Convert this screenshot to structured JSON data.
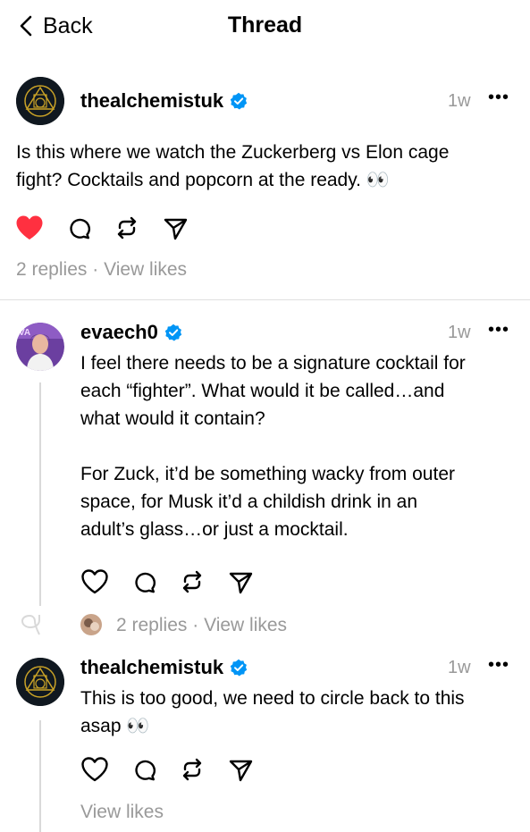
{
  "header": {
    "back_label": "Back",
    "title": "Thread"
  },
  "post": {
    "username": "thealchemistuk",
    "time": "1w",
    "text_line1": "Is this where we watch the Zuckerberg vs Elon cage",
    "text_line2": "fight? Cocktails and popcorn at the ready.",
    "emoji": "👀",
    "liked": true,
    "replies_label": "2 replies",
    "separator": "·",
    "likes_label": "View likes"
  },
  "reply1": {
    "username": "evaech0",
    "time": "1w",
    "lines": [
      "I feel there needs to be a signature cocktail for",
      "each “fighter”. What would it be called…and",
      "what would it contain?",
      "",
      "For Zuck, it’d be something wacky from outer",
      "space, for Musk it’d a childish drink in an",
      "adult’s glass…or just a mocktail."
    ],
    "replies_label": "2 replies",
    "separator": "·",
    "likes_label": "View likes"
  },
  "reply2": {
    "username": "thealchemistuk",
    "time": "1w",
    "text_line1": "This is too good, we need to circle back to this",
    "text_line2": "asap",
    "emoji": "👀",
    "likes_label": "View likes"
  },
  "colors": {
    "like_red": "#ff3040",
    "verified_blue": "#0095f6",
    "muted": "#999999"
  }
}
